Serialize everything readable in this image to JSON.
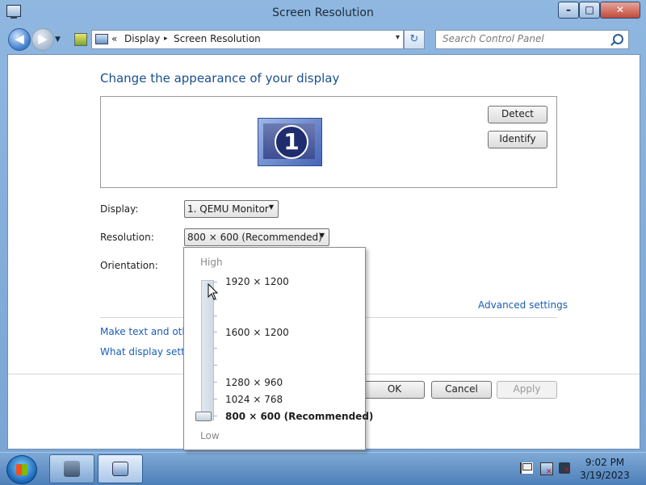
{
  "window": {
    "title": "Screen Resolution",
    "controls": {
      "minimize": "–",
      "maximize": "□",
      "close": "✕"
    }
  },
  "navigation": {
    "back_icon": "back-arrow-icon",
    "forward_icon": "forward-arrow-icon",
    "address": {
      "prefix": "«",
      "crumbs": [
        "Display",
        "Screen Resolution"
      ],
      "separator": "▸",
      "dropdown": "▾"
    },
    "refresh": "↻",
    "search": {
      "placeholder": "Search Control Panel"
    }
  },
  "main": {
    "heading": "Change the appearance of your display",
    "monitor_number": "1",
    "detect_label": "Detect",
    "identify_label": "Identify",
    "display": {
      "label": "Display:",
      "value": "1. QEMU Monitor"
    },
    "resolution": {
      "label": "Resolution:",
      "value": "800 × 600 (Recommended)"
    },
    "orientation": {
      "label": "Orientation:"
    },
    "advanced_settings": "Advanced settings",
    "link_text_size": "Make text and other",
    "link_display_settings": "What display setting",
    "ok_label": "OK",
    "cancel_label": "Cancel",
    "apply_label": "Apply"
  },
  "resolution_popup": {
    "high_label": "High",
    "low_label": "Low",
    "options": [
      "1920 × 1200",
      "1600 × 1200",
      "1280 × 960",
      "1024 × 768",
      "800 × 600 (Recommended)"
    ],
    "selected_index": 4
  },
  "taskbar": {
    "time": "9:02 PM",
    "date": "3/19/2023"
  },
  "colors": {
    "heading": "#1a4f90",
    "link": "#1a5fb4",
    "window_frame": "#8fb7e0",
    "taskbar": "#4d7fb9"
  }
}
